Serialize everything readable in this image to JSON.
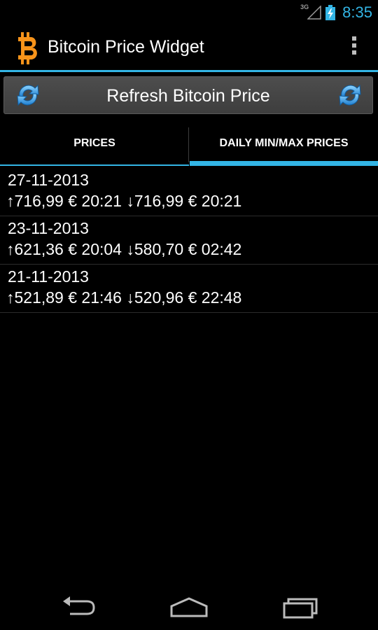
{
  "status_bar": {
    "network": "3G",
    "time": "8:35"
  },
  "action_bar": {
    "title": "Bitcoin Price Widget"
  },
  "refresh": {
    "label": "Refresh Bitcoin Price"
  },
  "tabs": [
    {
      "label": "PRICES",
      "selected": false
    },
    {
      "label": "DAILY MIN/MAX PRICES",
      "selected": true
    }
  ],
  "prices": [
    {
      "date": "27-11-2013",
      "high": "↑716,99 € 20:21",
      "low": "↓716,99 € 20:21"
    },
    {
      "date": "23-11-2013",
      "high": "↑621,36 € 20:04",
      "low": "↓580,70 € 02:42"
    },
    {
      "date": "21-11-2013",
      "high": "↑521,89 € 21:46",
      "low": "↓520,96 € 22:48"
    }
  ],
  "colors": {
    "accent": "#33b5e5",
    "bitcoin": "#f7931a"
  },
  "icons": {
    "logo": "bitcoin-logo-icon",
    "refresh": "refresh-icon",
    "overflow": "overflow-menu-icon",
    "back": "back-icon",
    "home": "home-icon",
    "recent": "recent-apps-icon"
  }
}
